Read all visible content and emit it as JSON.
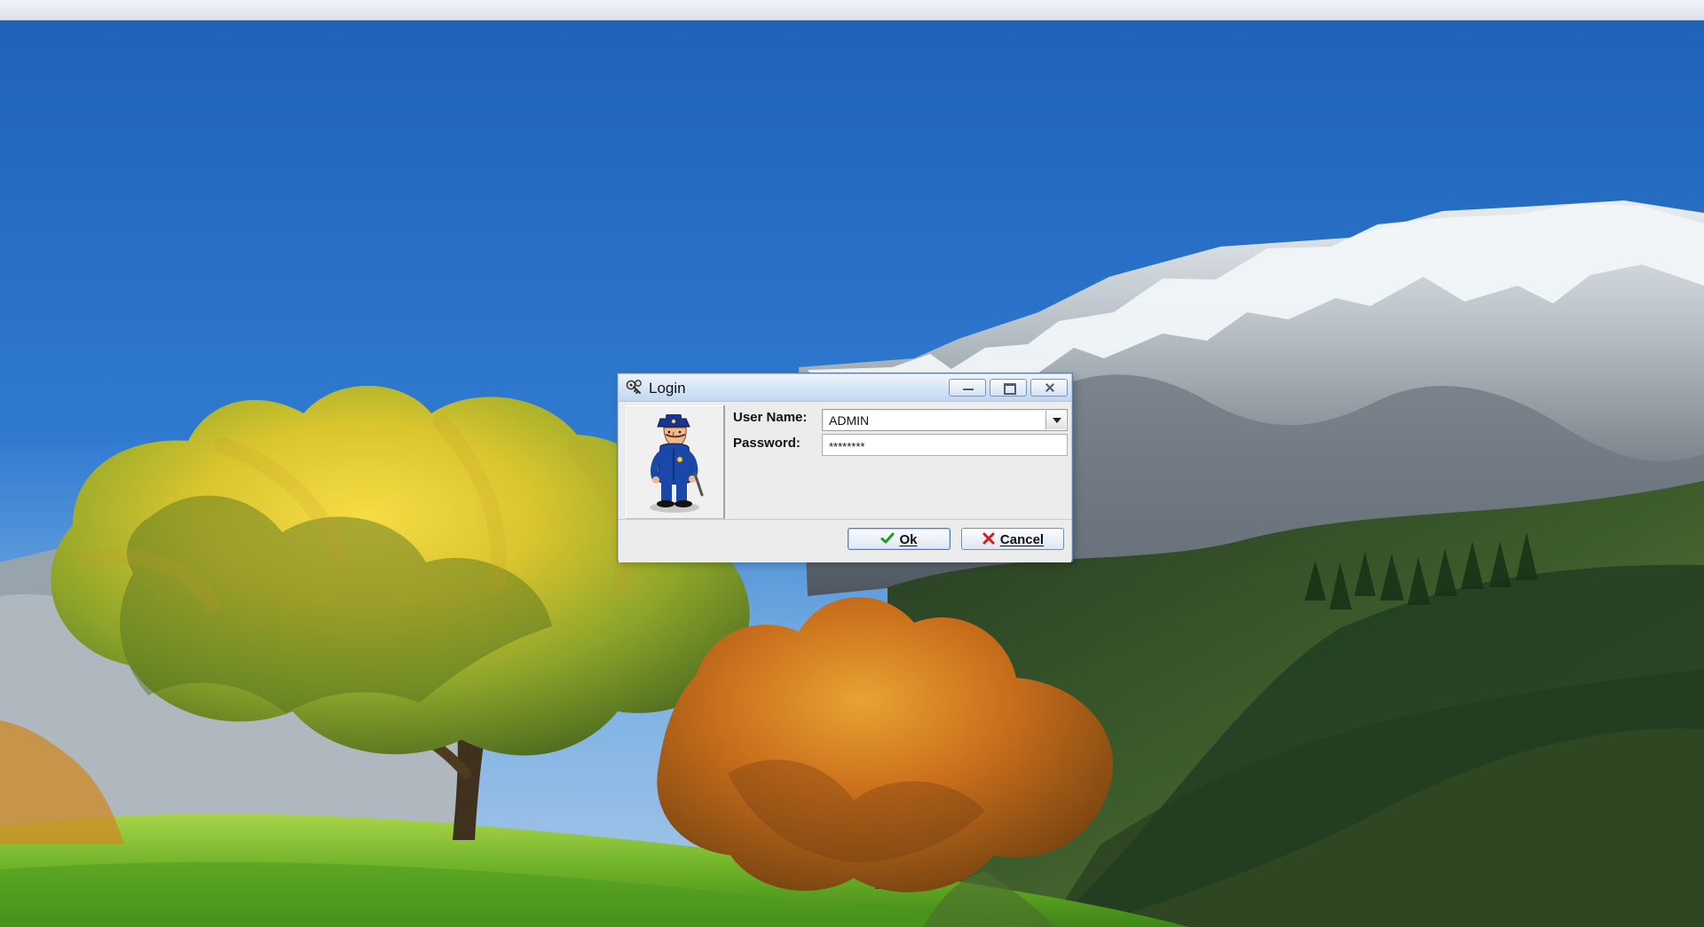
{
  "desktop": {
    "background_name": "mountain-autumn-landscape"
  },
  "login_window": {
    "title": "Login",
    "title_icon": "keys-icon",
    "window_controls": {
      "minimize_icon": "minimize-icon",
      "maximize_icon": "maximize-icon",
      "close_icon": "close-icon"
    },
    "officer_image": "police-officer-illustration",
    "fields": {
      "username_label": "User Name:",
      "username_value": "ADMIN",
      "password_label": "Password:",
      "password_value": "********"
    },
    "buttons": {
      "ok_label": "Ok",
      "ok_icon": "check-icon",
      "cancel_label": "Cancel",
      "cancel_icon": "cancel-x-icon"
    }
  },
  "colors": {
    "sky_blue": "#2f73c9",
    "window_blue": "#d9e6f6",
    "window_border": "#5f7ea7",
    "ok_check": "#1f9b25",
    "cancel_x": "#d51b1b"
  }
}
